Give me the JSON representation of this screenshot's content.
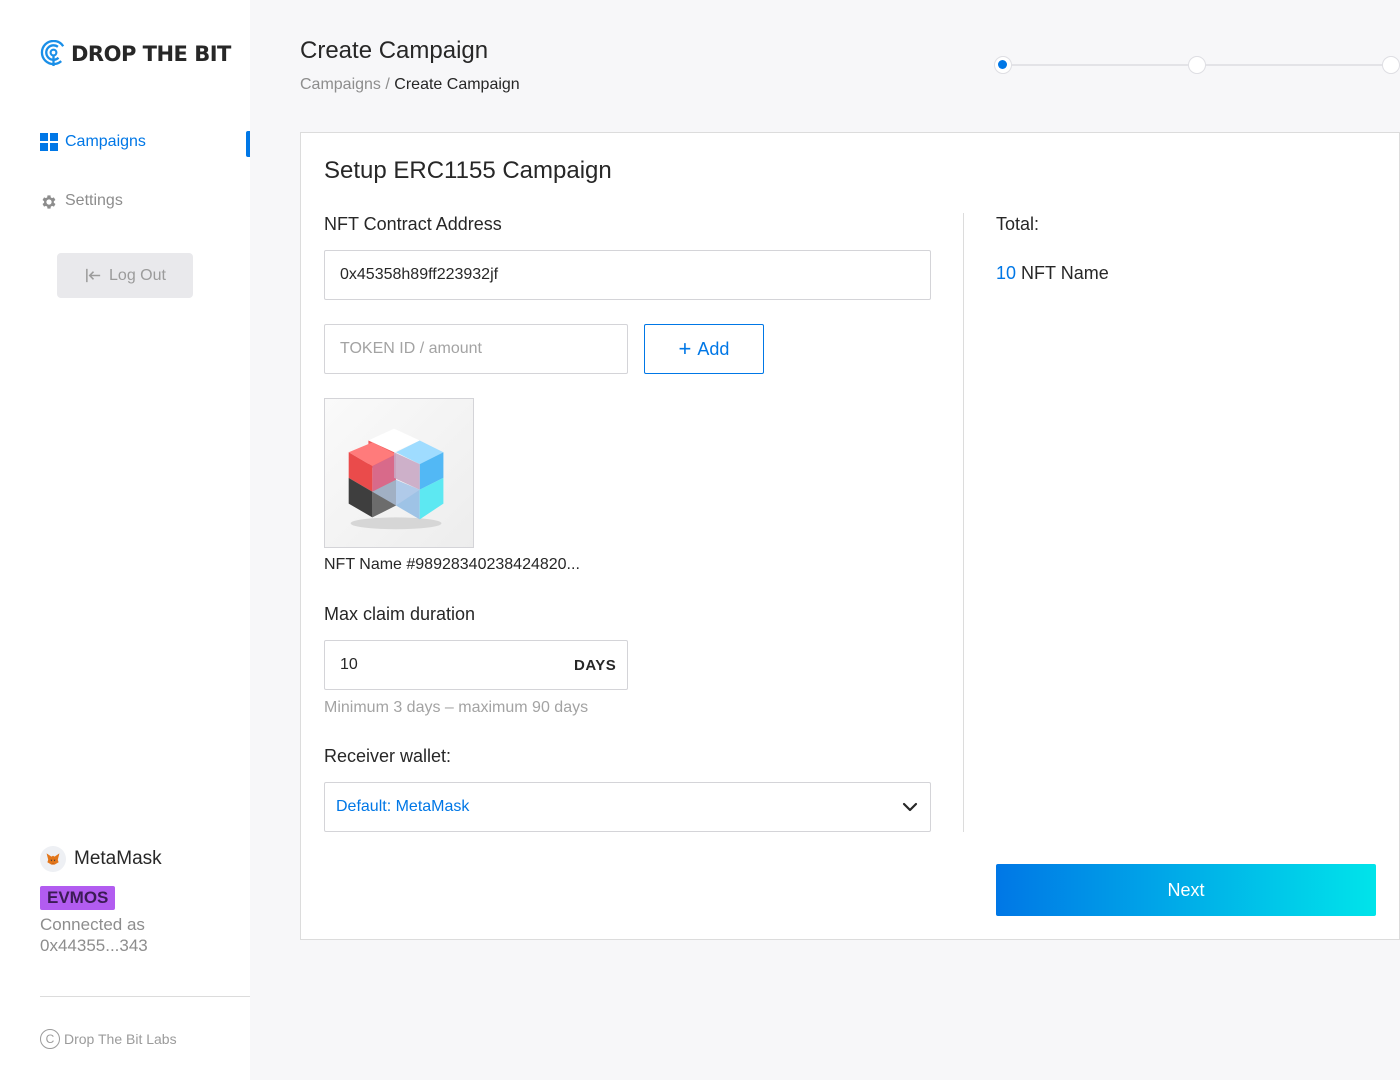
{
  "brand": {
    "name": "DROP THE BIT"
  },
  "sidebar": {
    "items": [
      {
        "label": "Campaigns",
        "icon": "grid-icon",
        "active": true
      },
      {
        "label": "Settings",
        "icon": "gear-icon",
        "active": false
      }
    ],
    "logout_label": "Log Out"
  },
  "wallet": {
    "name": "MetaMask",
    "chain": "EVMOS",
    "connected_label": "Connected as",
    "address": "0x44355...343"
  },
  "footer": {
    "copyright": "Drop The Bit Labs"
  },
  "header": {
    "title": "Create Campaign",
    "breadcrumb_parent": "Campaigns",
    "breadcrumb_separator": "/",
    "breadcrumb_current": "Create Campaign",
    "steps_total": 3,
    "step_current": 1
  },
  "form": {
    "title": "Setup ERC1155 Campaign",
    "contract_label": "NFT Contract Address",
    "contract_value": "0x45358h89ff223932jf",
    "token_placeholder": "TOKEN ID / amount",
    "add_label": "Add",
    "nft_name": "NFT Name #98928340238424820...",
    "duration_label": "Max claim duration",
    "duration_value": "10",
    "duration_unit": "DAYS",
    "duration_hint": "Minimum 3 days – maximum 90 days",
    "receiver_label": "Receiver wallet:",
    "receiver_value": "Default: MetaMask"
  },
  "summary": {
    "total_label": "Total:",
    "quantity": "10",
    "item_name": "NFT Name"
  },
  "actions": {
    "next_label": "Next"
  },
  "colors": {
    "accent": "#0077e6",
    "gradient_end": "#00e4ea",
    "chain_badge": "#b25cf0",
    "muted": "#8d8d8d"
  }
}
